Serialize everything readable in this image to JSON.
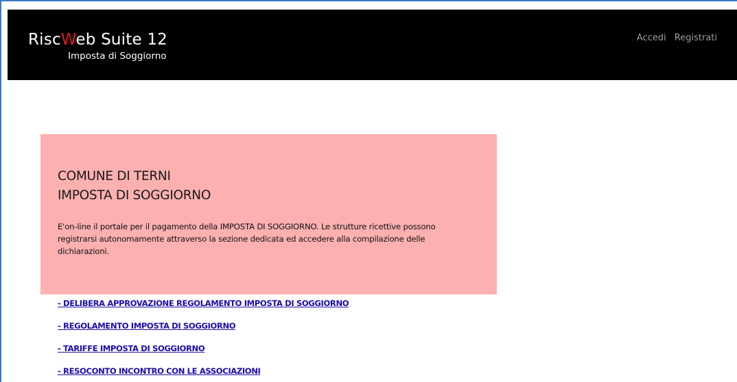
{
  "header": {
    "brand_prefix": "Risc",
    "brand_accent": "W",
    "brand_suffix": "eb Suite 12",
    "brand_subtitle": "Imposta di Soggiorno",
    "nav": {
      "login_label": "Accedi",
      "register_label": "Registrati"
    }
  },
  "notice": {
    "title_line1": "COMUNE DI TERNI",
    "title_line2": "IMPOSTA DI SOGGIORNO",
    "text": "E'on-line il portale per il pagamento della IMPOSTA DI SOGGIORNO. Le strutture ricettive possono registrarsi autonomamente attraverso la sezione dedicata ed accedere alla compilazione delle dichiarazioni."
  },
  "links": [
    {
      "label": "- DELIBERA APPROVAZIONE REGOLAMENTO IMPOSTA DI SOGGIORNO"
    },
    {
      "label": "- REGOLAMENTO IMPOSTA DI SOGGIORNO"
    },
    {
      "label": "- TARIFFE IMPOSTA DI SOGGIORNO"
    },
    {
      "label": "- RESOCONTO INCONTRO CON LE ASSOCIAZIONI"
    }
  ],
  "colors": {
    "navbar_bg": "#000000",
    "brand_accent": "#e51b1b",
    "panel_bg": "#fdb0b0",
    "link": "#1a0dab",
    "nav_link": "#9d9d9d"
  }
}
